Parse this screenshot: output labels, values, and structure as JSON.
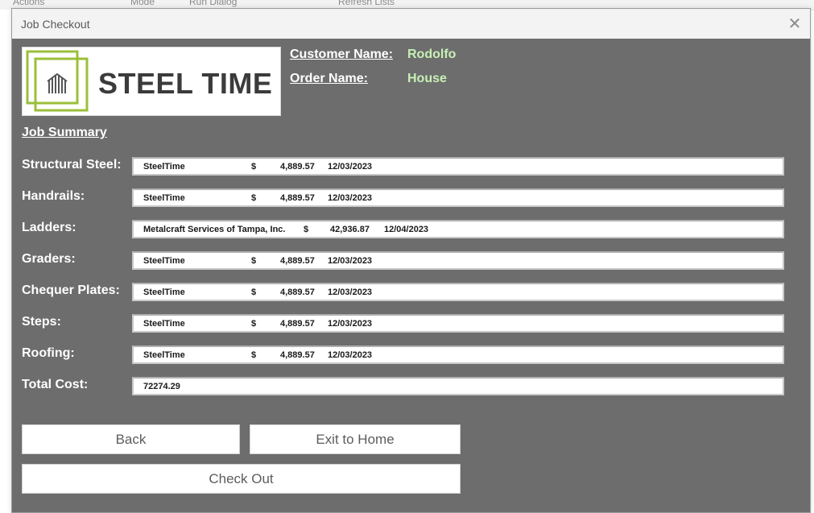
{
  "background_app": {
    "items": [
      "Actions",
      "Mode",
      "Run Dialog",
      "Refresh Lists"
    ]
  },
  "window": {
    "title": "Job Checkout",
    "close_glyph": "✕",
    "close_icon": "close-icon"
  },
  "logo": {
    "text": "STEEL TIME",
    "icon": "steel-beams-icon",
    "accent_color": "#9bbf3a"
  },
  "customer": {
    "label": "Customer Name:",
    "value": "Rodolfo"
  },
  "order": {
    "label": "Order Name:",
    "value": "House"
  },
  "summary": {
    "title": "Job Summary",
    "rows": [
      {
        "label": "Structural Steel:",
        "vendor": "SteelTime",
        "currency": "$",
        "amount": "4,889.57",
        "date": "12/03/2023"
      },
      {
        "label": "Handrails:",
        "vendor": "SteelTime",
        "currency": "$",
        "amount": "4,889.57",
        "date": "12/03/2023"
      },
      {
        "label": "Ladders:",
        "vendor": "Metalcraft Services of Tampa, Inc.",
        "currency": "$",
        "amount": "42,936.87",
        "date": "12/04/2023"
      },
      {
        "label": "Graders:",
        "vendor": "SteelTime",
        "currency": "$",
        "amount": "4,889.57",
        "date": "12/03/2023"
      },
      {
        "label": "Chequer Plates:",
        "vendor": "SteelTime",
        "currency": "$",
        "amount": "4,889.57",
        "date": "12/03/2023"
      },
      {
        "label": "Steps:",
        "vendor": "SteelTime",
        "currency": "$",
        "amount": "4,889.57",
        "date": "12/03/2023"
      },
      {
        "label": "Roofing:",
        "vendor": "SteelTime",
        "currency": "$",
        "amount": "4,889.57",
        "date": "12/03/2023"
      }
    ],
    "total_label": "Total Cost:",
    "total_value": "72274.29"
  },
  "buttons": {
    "back": "Back",
    "exit_home": "Exit to Home",
    "check_out": "Check Out"
  },
  "colors": {
    "dialog_bg": "#6d6d6d",
    "value_text": "#c8f0b4",
    "label_text": "#ffffff"
  }
}
